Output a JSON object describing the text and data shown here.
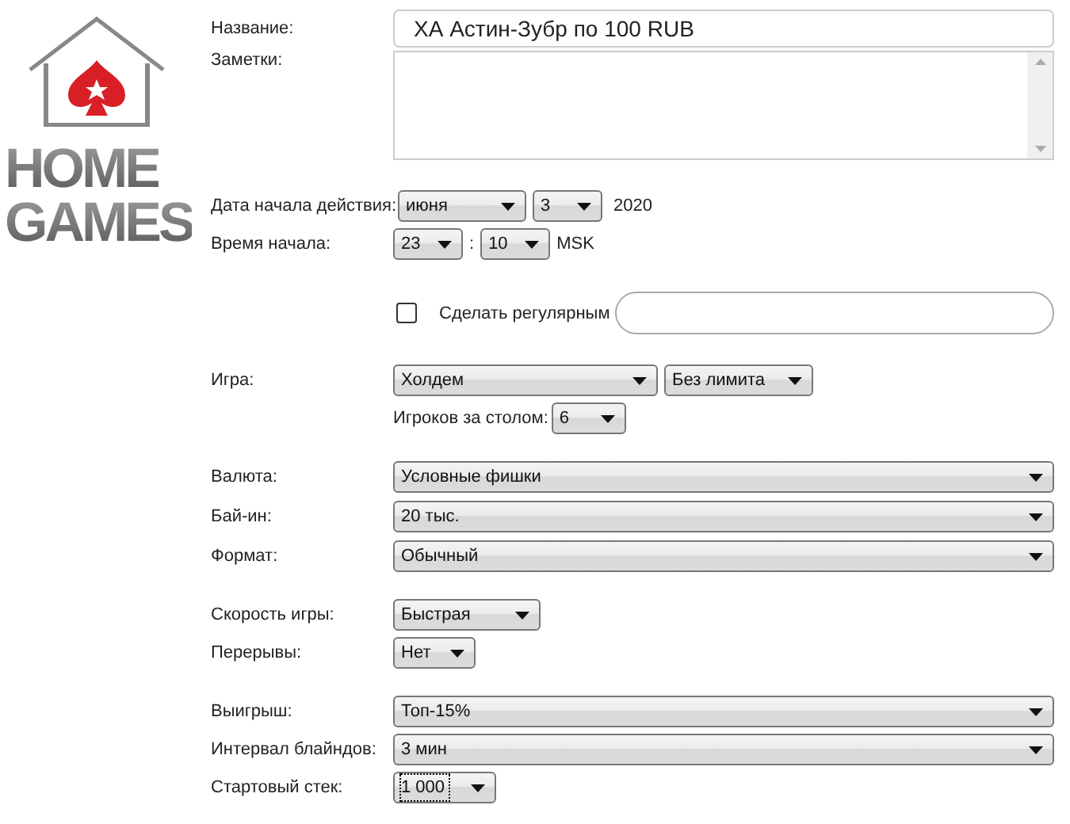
{
  "logo": {
    "line1": "HOME",
    "line2": "GAMES"
  },
  "name": {
    "label": "Название:",
    "value": "ХА Астин-Зубр по 100 RUB"
  },
  "notes": {
    "label": "Заметки:"
  },
  "start_date": {
    "label": "Дата начала действия:",
    "month": "июня",
    "day": "3",
    "year": "2020"
  },
  "start_time": {
    "label": "Время начала:",
    "hour": "23",
    "separator": ":",
    "minute": "10",
    "timezone": "MSK"
  },
  "regular": {
    "label": "Сделать регулярным",
    "checked": false
  },
  "game": {
    "label": "Игра:",
    "type": "Холдем",
    "limit": "Без лимита",
    "players_label": "Игроков за столом:",
    "players": "6"
  },
  "currency": {
    "label": "Валюта:",
    "value": "Условные фишки"
  },
  "buy_in": {
    "label": "Бай-ин:",
    "value": "20 тыс."
  },
  "format": {
    "label": "Формат:",
    "value": "Обычный"
  },
  "speed": {
    "label": "Скорость игры:",
    "value": "Быстрая"
  },
  "breaks": {
    "label": "Перерывы:",
    "value": "Нет"
  },
  "payout": {
    "label": "Выигрыш:",
    "value": "Топ-15%"
  },
  "blind_interval": {
    "label": "Интервал блайндов:",
    "value": "3 мин"
  },
  "starting_stack": {
    "label": "Стартовый стек:",
    "value": "1 000",
    "focused": true
  }
}
